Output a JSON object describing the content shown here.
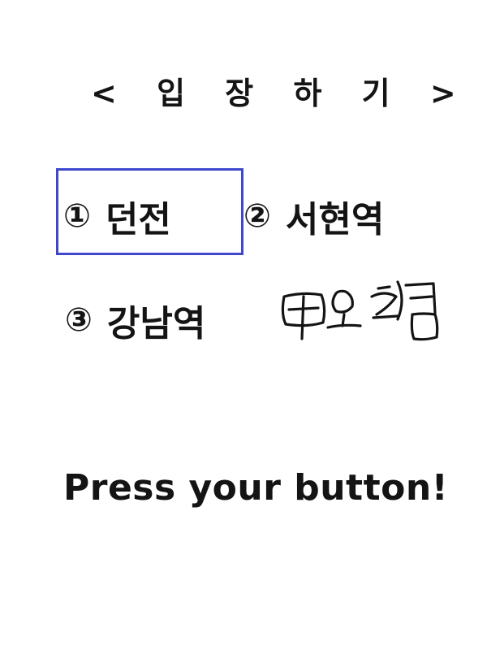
{
  "title": "< 입 장 하 기 >",
  "options": [
    {
      "number": "①",
      "label": "던전",
      "selected": true
    },
    {
      "number": "②",
      "label": "서현역",
      "selected": false
    },
    {
      "number": "③",
      "label": "강남역",
      "selected": false
    }
  ],
  "handwritten_note": "마오졍",
  "prompt": "Press your button!",
  "colors": {
    "text": "#141414",
    "selection_border": "#3f48cc",
    "background": "#ffffff"
  }
}
